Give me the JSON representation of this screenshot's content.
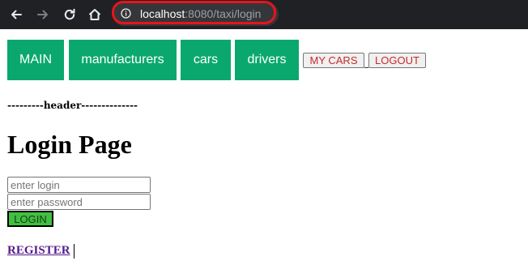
{
  "browser": {
    "url_host": "localhost",
    "url_rest": ":8080/taxi/login"
  },
  "nav": {
    "main_label": "MAIN",
    "manufacturers_label": "manufacturers",
    "cars_label": "cars",
    "drivers_label": "drivers",
    "my_cars_label": "MY CARS",
    "logout_label": "LOGOUT"
  },
  "page": {
    "header_text": "---------header--------------",
    "title": "Login Page",
    "login_placeholder": "enter login",
    "password_placeholder": "enter password",
    "login_button": "LOGIN",
    "register_link": "REGISTER"
  },
  "colors": {
    "menu_bg": "#0aa86f",
    "login_btn_bg": "#40c040",
    "highlight": "#e8141b"
  }
}
